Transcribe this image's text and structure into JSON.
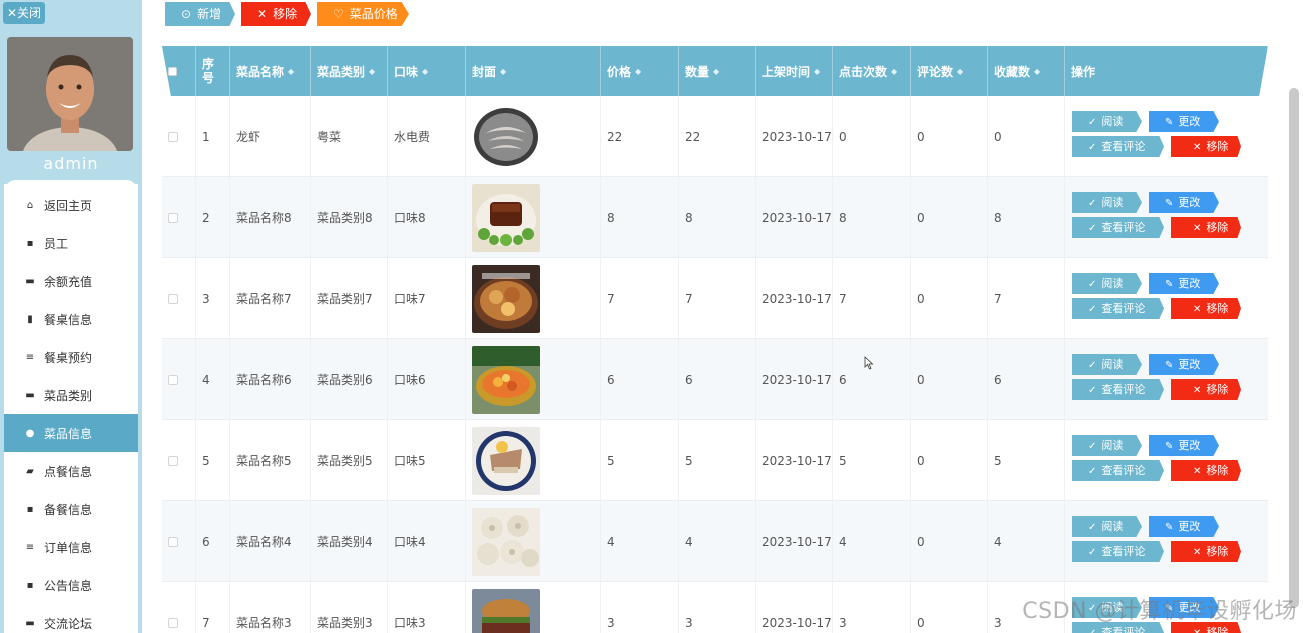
{
  "sidebar": {
    "close_label": "✕关闭",
    "username": "admin",
    "menu": [
      {
        "label": "返回主页",
        "icon": "home-icon",
        "glyph": "⌂",
        "active": false
      },
      {
        "label": "员工",
        "icon": "grid-icon",
        "glyph": "▪",
        "active": false
      },
      {
        "label": "余额充值",
        "icon": "comment-icon",
        "glyph": "▬",
        "active": false
      },
      {
        "label": "餐桌信息",
        "icon": "clipboard-icon",
        "glyph": "▮",
        "active": false
      },
      {
        "label": "餐桌预约",
        "icon": "list-icon",
        "glyph": "≡",
        "active": false
      },
      {
        "label": "菜品类别",
        "icon": "monitor-icon",
        "glyph": "▬",
        "active": false
      },
      {
        "label": "菜品信息",
        "icon": "location-icon",
        "glyph": "●",
        "active": true
      },
      {
        "label": "点餐信息",
        "icon": "thumbs-up-icon",
        "glyph": "▰",
        "active": false
      },
      {
        "label": "备餐信息",
        "icon": "grid-icon",
        "glyph": "▪",
        "active": false
      },
      {
        "label": "订单信息",
        "icon": "list-icon",
        "glyph": "≡",
        "active": false
      },
      {
        "label": "公告信息",
        "icon": "grid-icon",
        "glyph": "▪",
        "active": false
      },
      {
        "label": "交流论坛",
        "icon": "monitor-icon",
        "glyph": "▬",
        "active": false
      }
    ]
  },
  "toolbar": {
    "add_label": "新增",
    "remove_label": "移除",
    "price_label": "菜品价格"
  },
  "table": {
    "headers": [
      "序号",
      "菜品名称",
      "菜品类别",
      "口味",
      "封面",
      "价格",
      "数量",
      "上架时间",
      "点击次数",
      "评论数",
      "收藏数",
      "操作"
    ],
    "rows": [
      {
        "no": "1",
        "name": "龙虾",
        "category": "粤菜",
        "taste": "水电费",
        "price": "22",
        "qty": "22",
        "date": "2023-10-17",
        "clicks": "0",
        "comments": "0",
        "favs": "0",
        "cover": "shrimp"
      },
      {
        "no": "2",
        "name": "菜品名称8",
        "category": "菜品类别8",
        "taste": "口味8",
        "price": "8",
        "qty": "8",
        "date": "2023-10-17",
        "clicks": "8",
        "comments": "0",
        "favs": "8",
        "cover": "pork"
      },
      {
        "no": "3",
        "name": "菜品名称7",
        "category": "菜品类别7",
        "taste": "口味7",
        "price": "7",
        "qty": "7",
        "date": "2023-10-17",
        "clicks": "7",
        "comments": "0",
        "favs": "7",
        "cover": "claypot"
      },
      {
        "no": "4",
        "name": "菜品名称6",
        "category": "菜品类别6",
        "taste": "口味6",
        "price": "6",
        "qty": "6",
        "date": "2023-10-17",
        "clicks": "6",
        "comments": "0",
        "favs": "6",
        "cover": "pineapple"
      },
      {
        "no": "5",
        "name": "菜品名称5",
        "category": "菜品类别5",
        "taste": "口味5",
        "price": "5",
        "qty": "5",
        "date": "2023-10-17",
        "clicks": "5",
        "comments": "0",
        "favs": "5",
        "cover": "plate"
      },
      {
        "no": "6",
        "name": "菜品名称4",
        "category": "菜品类别4",
        "taste": "口味4",
        "price": "4",
        "qty": "4",
        "date": "2023-10-17",
        "clicks": "4",
        "comments": "0",
        "favs": "4",
        "cover": "dumplings"
      },
      {
        "no": "7",
        "name": "菜品名称3",
        "category": "菜品类别3",
        "taste": "口味3",
        "price": "3",
        "qty": "3",
        "date": "2023-10-17",
        "clicks": "3",
        "comments": "0",
        "favs": "3",
        "cover": "burger"
      }
    ],
    "actions": {
      "read": "阅读",
      "edit": "更改",
      "view_comments": "查看评论",
      "remove": "移除"
    }
  },
  "watermark": "CSDN @计算机毕设孵化场",
  "colors": {
    "accent": "#6db6cf",
    "sidebar": "#b6dcea",
    "edit": "#3e9bf0",
    "danger": "#f22b14",
    "orange": "#ff8c1a"
  }
}
